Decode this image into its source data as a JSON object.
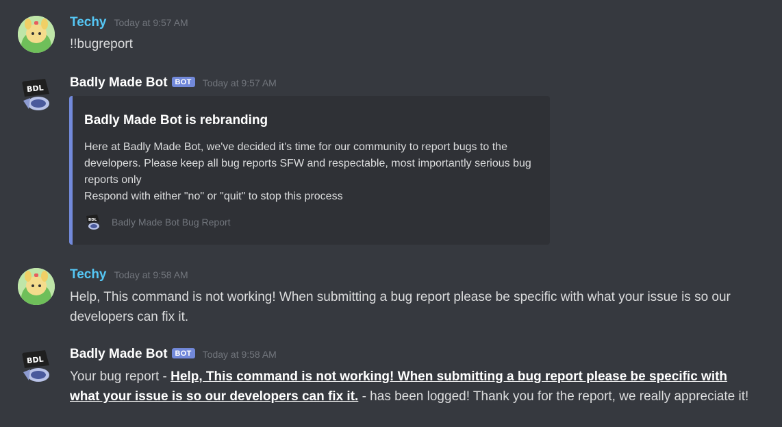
{
  "messages": [
    {
      "author": "Techy",
      "timestamp": "Today at 9:57 AM",
      "text": "!!bugreport"
    },
    {
      "author": "Badly Made Bot",
      "bot_tag": "BOT",
      "timestamp": "Today at 9:57 AM",
      "embed": {
        "title": "Badly Made Bot is rebranding",
        "description_lines": [
          "Here at Badly Made Bot, we've decided it's time for our community to report bugs to the developers. Please keep all bug reports SFW and respectable, most importantly serious bug reports only",
          "Respond with either \"no\" or \"quit\" to stop this process"
        ],
        "footer": "Badly Made Bot Bug Report",
        "footer_icon_text": "BDL",
        "accent": "#7289da"
      }
    },
    {
      "author": "Techy",
      "timestamp": "Today at 9:58 AM",
      "text": "Help, This command is not working! When submitting a bug report please be specific with what your issue is so our developers can fix it."
    },
    {
      "author": "Badly Made Bot",
      "bot_tag": "BOT",
      "timestamp": "Today at 9:58 AM",
      "text_prefix": "Your bug report - ",
      "text_link": "Help, This command is not working! When submitting a bug report please be specific with what your issue is so our developers can fix it.",
      "text_suffix": " - has been logged! Thank you for the report, we really appreciate it!"
    }
  ],
  "avatar_bot_text": "BDL",
  "colors": {
    "background": "#36393f",
    "embed_background": "#2f3136",
    "techy_name": "#55c7f5",
    "bot_tag": "#7289da",
    "timestamp": "#72767d"
  }
}
